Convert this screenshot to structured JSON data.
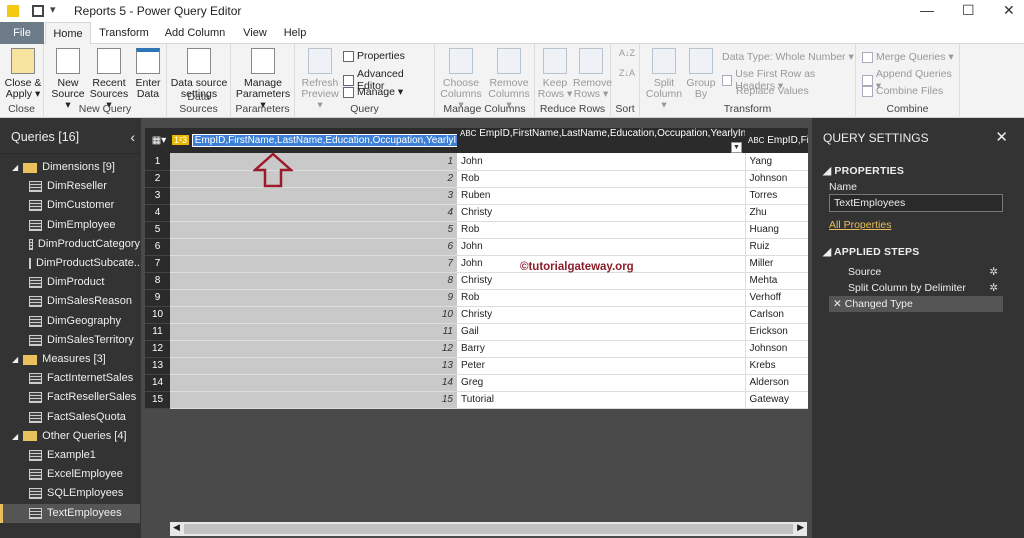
{
  "window": {
    "title": "Reports 5 - Power Query Editor",
    "minimize": "—",
    "maximize": "☐",
    "close": "✕"
  },
  "tabs": [
    "File",
    "Home",
    "Transform",
    "Add Column",
    "View",
    "Help"
  ],
  "ribbon": {
    "close": {
      "btn": "Close & Apply ▾",
      "group": "Close"
    },
    "new_query": {
      "new_source": "New Source ▾",
      "recent_sources": "Recent Sources ▾",
      "enter_data": "Enter Data",
      "group": "New Query"
    },
    "data_sources": {
      "btn": "Data source settings",
      "group": "Data Sources"
    },
    "parameters": {
      "btn": "Manage Parameters ▾",
      "group": "Parameters"
    },
    "query": {
      "refresh": "Refresh Preview ▾",
      "properties": "Properties",
      "advanced_editor": "Advanced Editor",
      "manage": "Manage ▾",
      "group": "Query"
    },
    "manage_columns": {
      "choose": "Choose Columns ▾",
      "remove": "Remove Columns ▾",
      "group": "Manage Columns"
    },
    "reduce_rows": {
      "keep": "Keep Rows ▾",
      "remove": "Remove Rows ▾",
      "group": "Reduce Rows"
    },
    "sort": {
      "group": "Sort",
      "asc": "A↓Z",
      "desc": "Z↓A"
    },
    "transform": {
      "split": "Split Column ▾",
      "group_by": "Group By",
      "data_type": "Data Type: Whole Number ▾",
      "first_row": "Use First Row as Headers ▾",
      "replace": "Replace Values",
      "group": "Transform"
    },
    "combine": {
      "merge": "Merge Queries ▾",
      "append": "Append Queries ▾",
      "combine_files": "Combine Files",
      "group": "Combine"
    }
  },
  "queries": {
    "title": "Queries [16]",
    "groups": [
      {
        "name": "Dimensions [9]",
        "items": [
          "DimReseller",
          "DimCustomer",
          "DimEmployee",
          "DimProductCategory",
          "DimProductSubcate...",
          "DimProduct",
          "DimSalesReason",
          "DimGeography",
          "DimSalesTerritory"
        ]
      },
      {
        "name": "Measures [3]",
        "items": [
          "FactInternetSales",
          "FactResellerSales",
          "FactSalesQuota"
        ]
      },
      {
        "name": "Other Queries [4]",
        "items": [
          "Example1",
          "ExcelEmployee",
          "SQLEmployees",
          "TextEmployees"
        ]
      }
    ],
    "selected": "TextEmployees"
  },
  "grid": {
    "columns": [
      {
        "type": "1²3",
        "name": "EmpID,FirstName,LastName,Education,Occupation,YearlyIncom"
      },
      {
        "type": "ABC",
        "name": "EmpID,FirstName,LastName,Education,Occupation,YearlyInc..."
      },
      {
        "type": "ABC",
        "name": "EmpID,Firs"
      }
    ],
    "rows": [
      [
        "1",
        "John",
        "Yang"
      ],
      [
        "2",
        "Rob",
        "Johnson"
      ],
      [
        "3",
        "Ruben",
        "Torres"
      ],
      [
        "4",
        "Christy",
        "Zhu"
      ],
      [
        "5",
        "Rob",
        "Huang"
      ],
      [
        "6",
        "John",
        "Ruiz"
      ],
      [
        "7",
        "John",
        "Miller"
      ],
      [
        "8",
        "Christy",
        "Mehta"
      ],
      [
        "9",
        "Rob",
        "Verhoff"
      ],
      [
        "10",
        "Christy",
        "Carlson"
      ],
      [
        "11",
        "Gail",
        "Erickson"
      ],
      [
        "12",
        "Barry",
        "Johnson"
      ],
      [
        "13",
        "Peter",
        "Krebs"
      ],
      [
        "14",
        "Greg",
        "Alderson"
      ],
      [
        "15",
        "Tutorial",
        "Gateway"
      ]
    ],
    "watermark": "©tutorialgateway.org"
  },
  "settings": {
    "title": "QUERY SETTINGS",
    "properties": "PROPERTIES",
    "name_label": "Name",
    "name_value": "TextEmployees",
    "all_properties": "All Properties",
    "applied_steps": "APPLIED STEPS",
    "steps": [
      "Source",
      "Split Column by Delimiter",
      "Changed Type"
    ]
  }
}
